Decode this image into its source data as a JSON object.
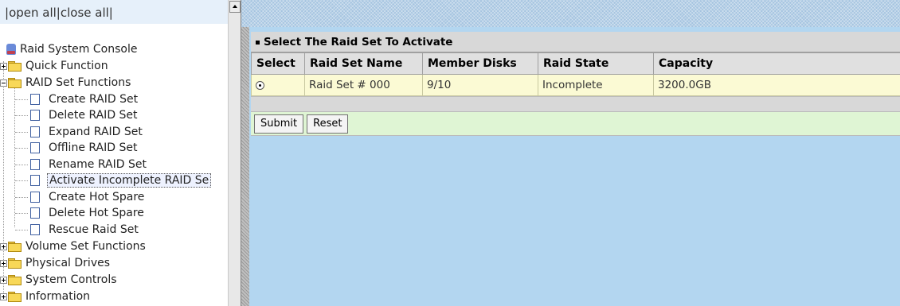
{
  "left_frame": {
    "open_all": "open all",
    "close_all": "close all",
    "separator": "|",
    "tree": [
      {
        "label": "Raid System Console",
        "type": "root"
      },
      {
        "label": "Quick Function",
        "type": "folder",
        "state": "closed"
      },
      {
        "label": "RAID Set Functions",
        "type": "folder",
        "state": "open",
        "children": [
          {
            "label": "Create RAID Set"
          },
          {
            "label": "Delete RAID Set"
          },
          {
            "label": "Expand RAID Set"
          },
          {
            "label": "Offline RAID Set"
          },
          {
            "label": "Rename RAID Set"
          },
          {
            "label": "Activate Incomplete RAID Se",
            "selected": true
          },
          {
            "label": "Create Hot Spare"
          },
          {
            "label": "Delete Hot Spare"
          },
          {
            "label": "Rescue Raid Set"
          }
        ]
      },
      {
        "label": "Volume Set Functions",
        "type": "folder",
        "state": "closed"
      },
      {
        "label": "Physical Drives",
        "type": "folder",
        "state": "closed"
      },
      {
        "label": "System Controls",
        "type": "folder",
        "state": "closed"
      },
      {
        "label": "Information",
        "type": "folder",
        "state": "closed"
      }
    ]
  },
  "main": {
    "panel_title": "Select The Raid Set To Activate",
    "columns": [
      "Select",
      "Raid Set Name",
      "Member Disks",
      "Raid State",
      "Capacity"
    ],
    "rows": [
      {
        "selected": true,
        "name": "Raid Set # 000",
        "member_disks": "9/10",
        "state": "Incomplete",
        "capacity": "3200.0GB"
      }
    ],
    "submit_label": "Submit",
    "reset_label": "Reset"
  },
  "colors": {
    "content_bg": "#b3d6f0",
    "row_bg": "#fbfad4",
    "action_row_bg": "#dff5d4",
    "header_bg": "#e0e0e0"
  }
}
